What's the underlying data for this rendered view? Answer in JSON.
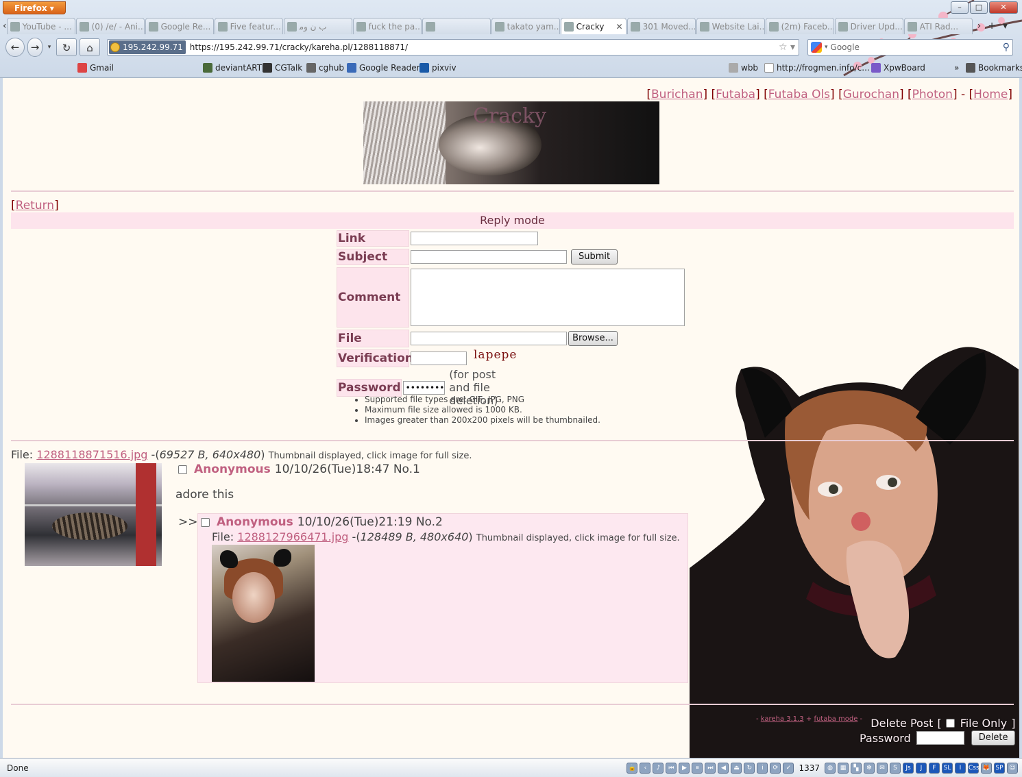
{
  "browser": {
    "menu_button": "Firefox",
    "tabs": [
      {
        "label": "YouTube - ...",
        "icon": "youtube-icon"
      },
      {
        "label": "(0) /e/ - Ani...",
        "icon": "board-icon"
      },
      {
        "label": "Google Re...",
        "icon": "google-reader-icon"
      },
      {
        "label": "Five featur...",
        "icon": "page-icon"
      },
      {
        "label": "ﺏ ﻥ ﻭﻣ",
        "icon": "avatar-icon"
      },
      {
        "label": "fuck the pa...",
        "icon": "page-icon"
      },
      {
        "label": "",
        "icon": "spinner-icon"
      },
      {
        "label": "takato yam...",
        "icon": "image-icon"
      },
      {
        "label": "Cracky",
        "icon": "cracky-icon",
        "active": true
      },
      {
        "label": "301 Moved...",
        "icon": "globe-icon"
      },
      {
        "label": "Website Lai...",
        "icon": "page-icon"
      },
      {
        "label": "(2m) Faceb...",
        "icon": "facebook-icon"
      },
      {
        "label": "Driver Upd...",
        "icon": "page-icon"
      },
      {
        "label": "ATI Rad...",
        "icon": "ati-icon"
      }
    ],
    "identity_badge": "195.242.99.71",
    "url": "https://195.242.99.71/cracky/kareha.pl/1288118871/",
    "search_engine": "Google",
    "bookmarks_left": [
      "Gmail",
      "deviantART",
      "CGTalk",
      "cghub",
      "Google Reader",
      "pixviv"
    ],
    "bookmarks_right": [
      "wbb",
      "http://frogmen.info/c...",
      "XpwBoard"
    ],
    "bookmarks_menu": "Bookmarks",
    "status_text": "Done",
    "counter": "1337"
  },
  "board": {
    "top_links": [
      "Burichan",
      "Futaba",
      "Futaba Ols",
      "Gurochan",
      "Photon"
    ],
    "home_link": "Home",
    "banner_title": "Cracky",
    "return_link": "Return",
    "reply_mode": "Reply mode",
    "form": {
      "link_label": "Link",
      "subject_label": "Subject",
      "comment_label": "Comment",
      "file_label": "File",
      "verification_label": "Verification",
      "password_label": "Password",
      "submit_label": "Submit",
      "browse_label": "Browse...",
      "captcha_text": "lapepe",
      "password_value": "••••••••",
      "password_note": "(for post and file deletion)"
    },
    "rules": [
      "Supported file types are: GIF, JPG, PNG",
      "Maximum file size allowed is 1000 KB.",
      "Images greater than 200x200 pixels will be thumbnailed."
    ],
    "op": {
      "file_prefix": "File:",
      "file_name": "1288118871516.jpg",
      "file_meta": "69527 B, 640x480",
      "thumb_note": "Thumbnail displayed, click image for full size.",
      "name": "Anonymous",
      "date": "10/10/26(Tue)18:47",
      "number": "No.1",
      "comment": "adore this"
    },
    "reply": {
      "arrows": ">>",
      "name": "Anonymous",
      "date": "10/10/26(Tue)21:19",
      "number": "No.2",
      "file_prefix": "File:",
      "file_name": "1288127966471.jpg",
      "file_meta": "128489 B, 480x640",
      "thumb_note": "Thumbnail displayed, click image for full size."
    },
    "footer": {
      "kareha_link": "kareha 3.1.3",
      "mode_link": "futaba mode",
      "delete_post_label": "Delete Post",
      "file_only_label": "File Only",
      "password_label": "Password",
      "delete_button": "Delete"
    }
  },
  "colors": {
    "link": "#c06080",
    "label_bg": "#fde4ec",
    "page_bg": "#fffaf2"
  }
}
